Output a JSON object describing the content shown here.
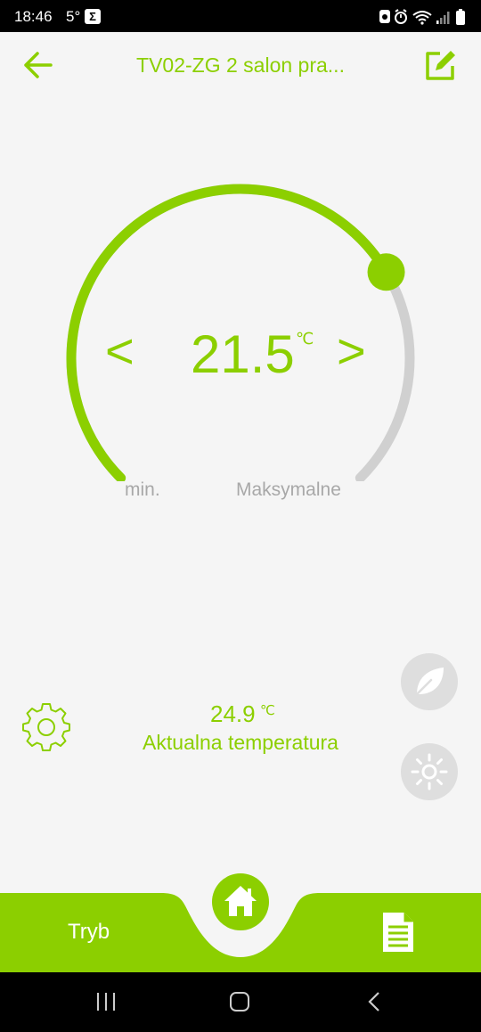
{
  "status_bar": {
    "time": "18:46",
    "temperature": "5°",
    "sigma_badge": "Σ"
  },
  "header": {
    "title": "TV02-ZG 2 salon pra...",
    "back_icon": "arrow-left-icon",
    "edit_icon": "edit-icon"
  },
  "dial": {
    "setpoint": "21.5",
    "unit": "℃",
    "decrease_label": "<",
    "increase_label": ">",
    "min_label": "min.",
    "max_label": "Maksymalne",
    "progress_fraction": 0.72
  },
  "current": {
    "value": "24.9",
    "unit": "℃",
    "label": "Aktualna temperatura"
  },
  "side_buttons": {
    "eco_icon": "leaf-icon",
    "comfort_icon": "sun-icon"
  },
  "bottom_bar": {
    "mode_label": "Tryb",
    "home_icon": "home-icon",
    "schedule_icon": "document-icon"
  },
  "colors": {
    "accent": "#8ccf00",
    "arc_inactive": "#d0d0d0",
    "background": "#f5f5f5",
    "side_button": "#dedede"
  }
}
